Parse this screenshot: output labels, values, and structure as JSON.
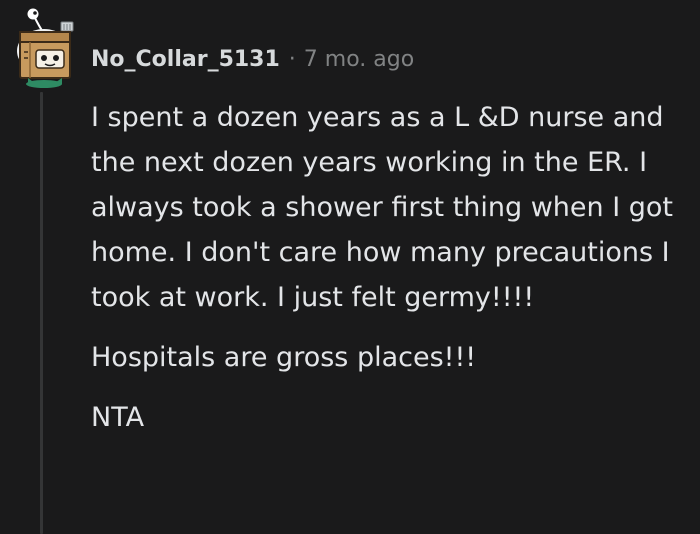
{
  "comment": {
    "author": "No_Collar_5131",
    "separator": "·",
    "timestamp": "7 mo. ago",
    "paragraphs": [
      "I spent a dozen years as a L &D nurse and the next dozen years working in the ER. I always took a shower first thing when I got home. I don't care how many precautions I took at work. I just felt germy!!!!",
      "Hospitals are gross places!!!",
      "NTA"
    ]
  },
  "colors": {
    "background": "#1a1a1b",
    "text": "#d7dadc",
    "muted": "#818384",
    "thread_line": "#343536"
  },
  "icons": {
    "avatar": "snoo-avatar-icon"
  }
}
